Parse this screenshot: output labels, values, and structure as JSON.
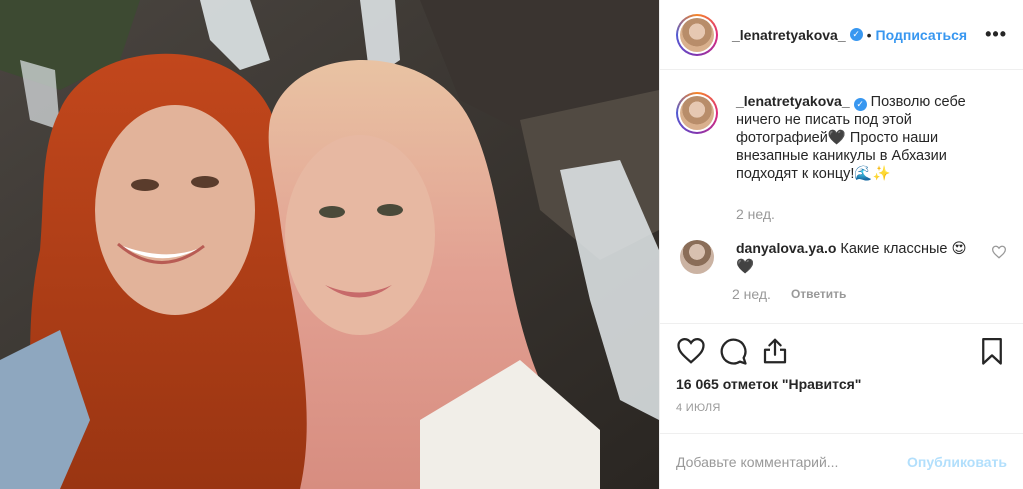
{
  "post": {
    "photo_alt": "Селфи двух девушек у водопада",
    "header": {
      "username": "_lenatretyakova_",
      "separator": "•",
      "follow_label": "Подписаться",
      "more_label": "•••"
    },
    "caption": {
      "username": "_lenatretyakova_",
      "text": "Позволю себе ничего не писать под этой фотографией🖤 Просто наши внезапные каникулы в Абхазии подходят к концу!🌊✨",
      "time": "2 нед."
    },
    "comments": [
      {
        "username": "danyalova.ya.o",
        "text": "Какие классные 😍🖤",
        "time": "2 нед.",
        "reply_label": "Ответить"
      }
    ],
    "likes_label": "16 065 отметок \"Нравится\"",
    "date_label": "4 ИЮЛЯ",
    "add_comment": {
      "placeholder": "Добавьте комментарий...",
      "publish_label": "Опубликовать"
    },
    "colors": {
      "link_blue": "#3897f0",
      "publish_disabled": "#b2dffc",
      "muted": "#999999"
    }
  }
}
